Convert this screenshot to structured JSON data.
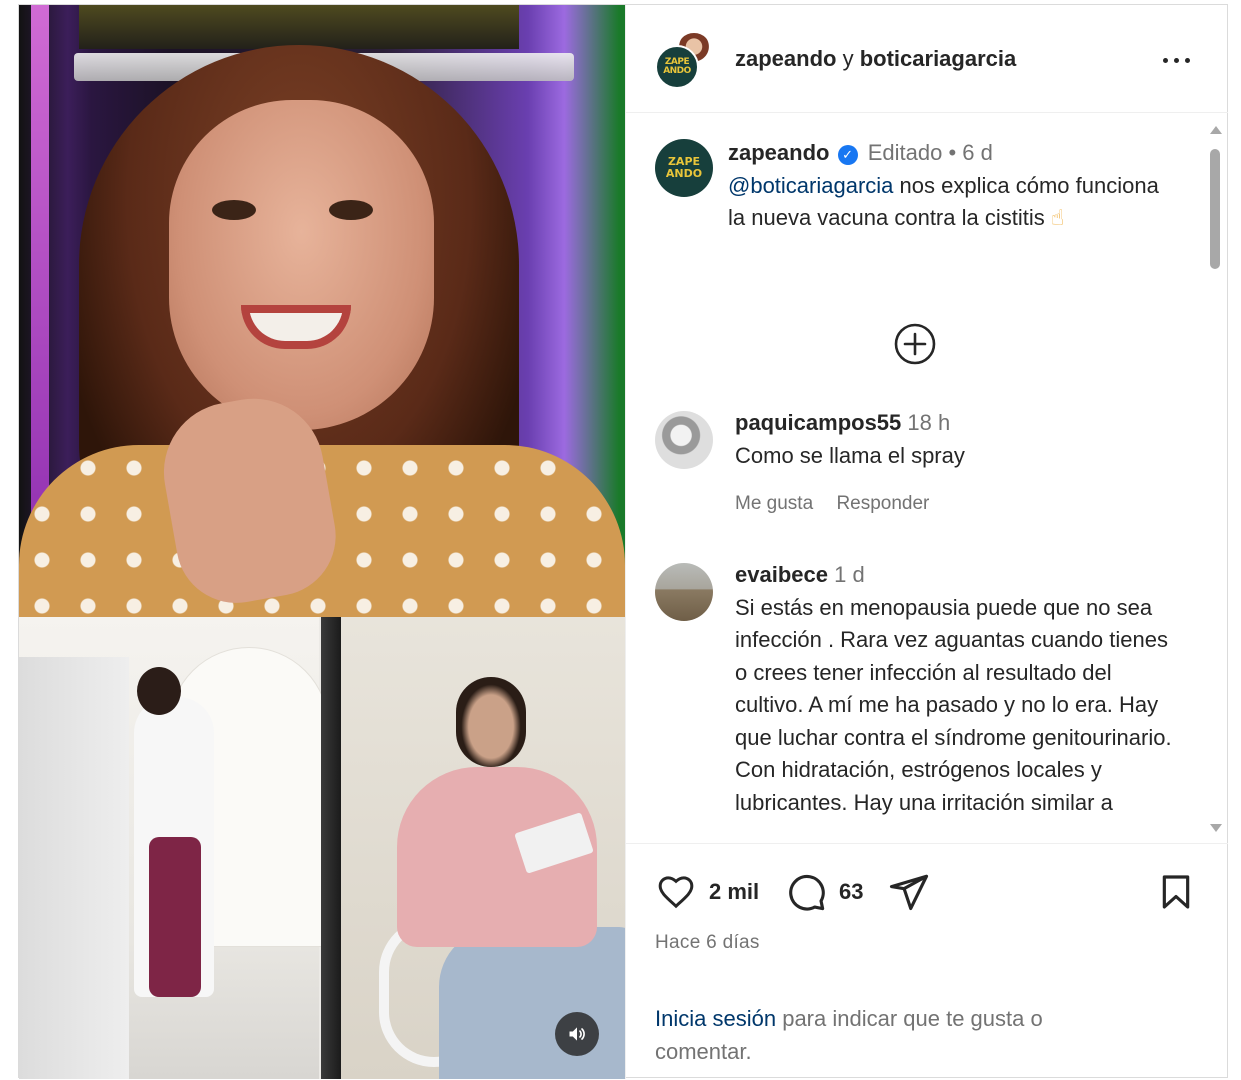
{
  "header": {
    "account_primary": "zapeando",
    "conjunction": "y",
    "account_secondary": "boticariagarcia"
  },
  "avatars": {
    "zapeando_logo_text": "ZAPE ANDO"
  },
  "caption": {
    "username": "zapeando",
    "edited": "Editado",
    "separator": "•",
    "time": "6 d",
    "mention": "@boticariagarcia",
    "text": "nos explica cómo funciona la nueva vacuna contra la cistitis",
    "emoji": "☝"
  },
  "comments": [
    {
      "username": "paquicampos55",
      "time": "18 h",
      "text": "Como se llama el spray",
      "like_label": "Me gusta",
      "reply_label": "Responder"
    },
    {
      "username": "evaibece",
      "time": "1 d",
      "text": "Si estás en menopausia puede que no sea infección . Rara vez aguantas cuando tienes o crees tener infección al resultado del cultivo. A mí me ha pasado y no lo era. Hay que luchar contra el síndrome genitourinario. Con hidratación, estrógenos locales y lubricantes. Hay una irritación similar a"
    }
  ],
  "actions": {
    "likes": "2 mil",
    "comments": "63",
    "posted": "Hace 6 días"
  },
  "login": {
    "link": "Inicia sesión",
    "text": "para indicar que te gusta o comentar."
  },
  "icons": {
    "more": "more-icon",
    "verified": "verified-badge-icon",
    "load_more": "plus-circle-icon",
    "like": "heart-icon",
    "comment": "comment-icon",
    "share": "share-icon",
    "save": "bookmark-icon",
    "sound": "speaker-icon"
  }
}
